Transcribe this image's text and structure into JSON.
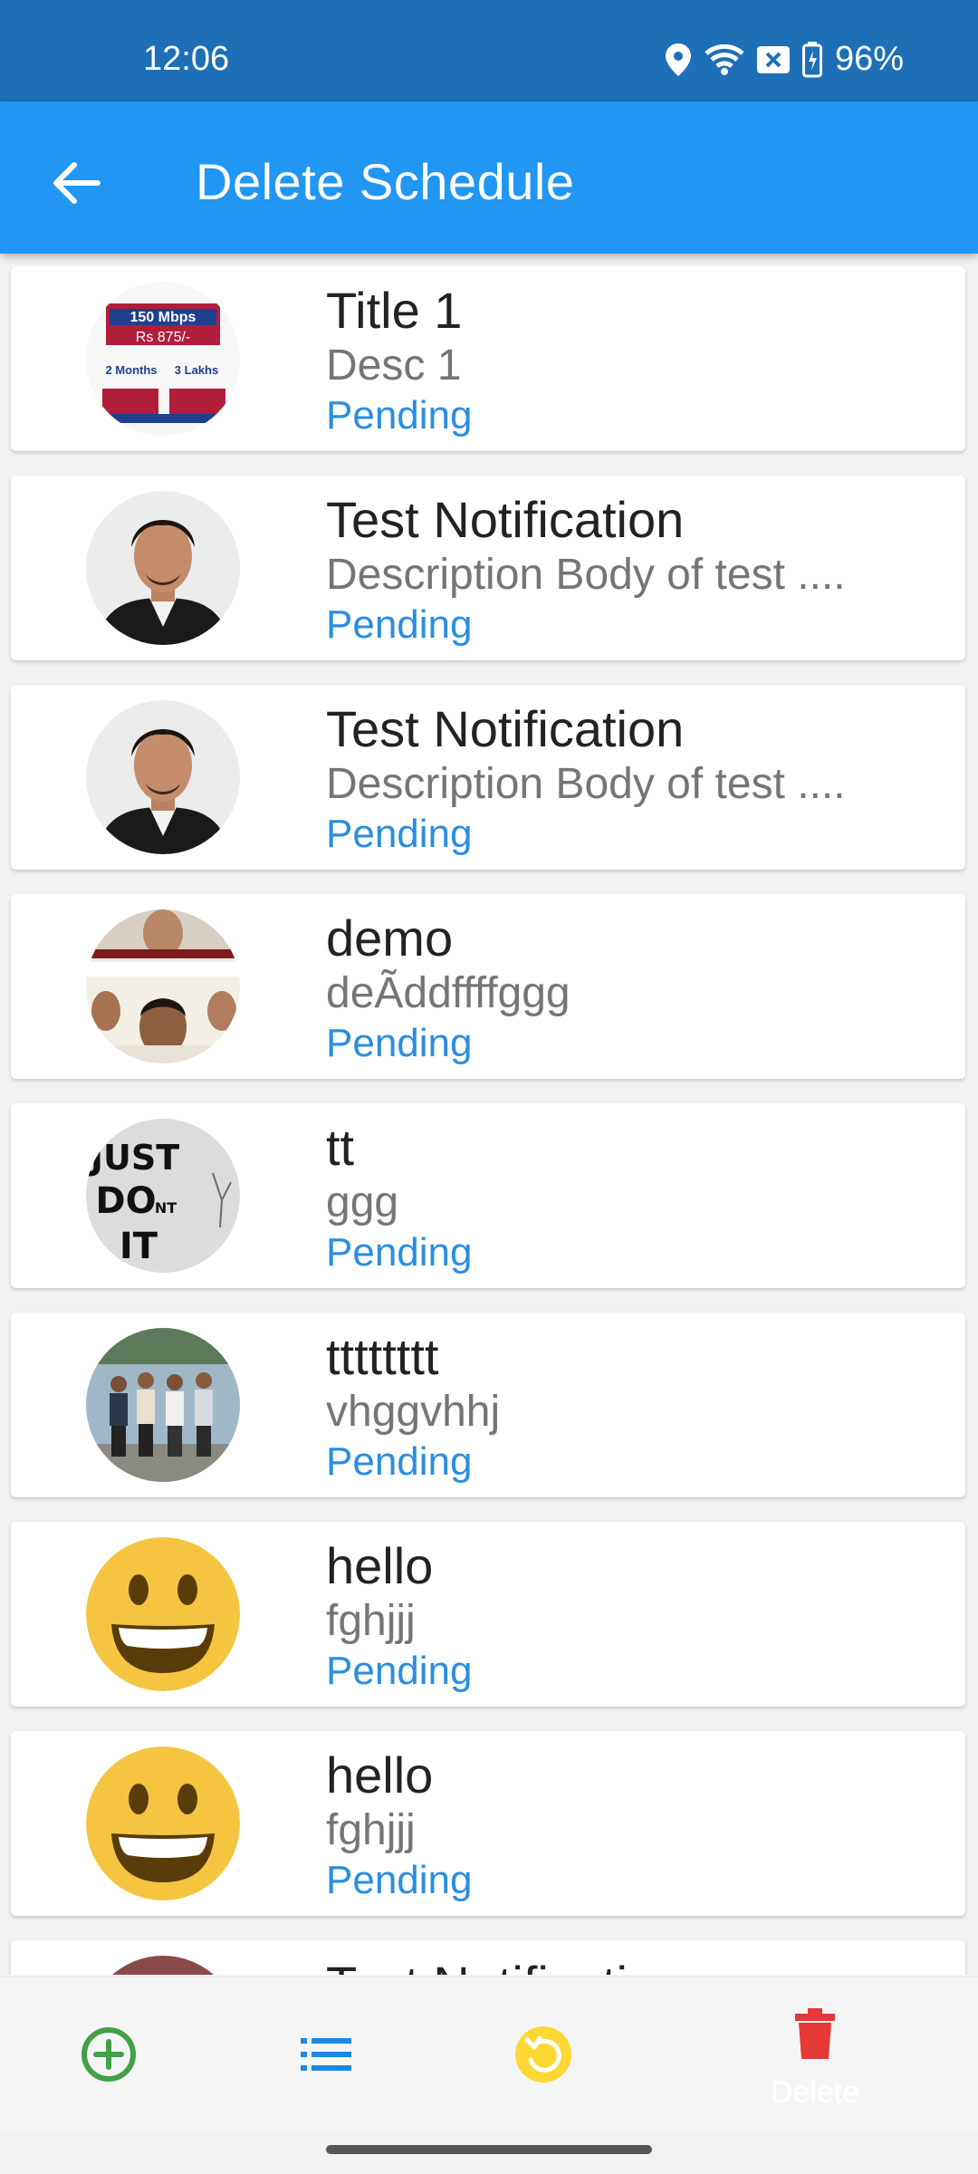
{
  "status_bar": {
    "time": "12:06",
    "battery": "96%"
  },
  "app_bar": {
    "title": "Delete Schedule"
  },
  "items": [
    {
      "title": "Title 1",
      "desc": "Desc 1",
      "status": "Pending",
      "avatar": "ad-banner-image"
    },
    {
      "title": "Test Notification",
      "desc": "Description Body of test ....",
      "status": "Pending",
      "avatar": "man-portrait-image"
    },
    {
      "title": "Test Notification",
      "desc": "Description Body of test ....",
      "status": "Pending",
      "avatar": "man-portrait-image"
    },
    {
      "title": "demo",
      "desc": "deÃddffffggg",
      "status": "Pending",
      "avatar": "actors-collage-image"
    },
    {
      "title": "tt",
      "desc": "ggg",
      "status": "Pending",
      "avatar": "just-do-it-image"
    },
    {
      "title": "tttttttt",
      "desc": "vhggvhhj",
      "status": "Pending",
      "avatar": "group-photo-image"
    },
    {
      "title": "hello",
      "desc": "fghjjj",
      "status": "Pending",
      "avatar": "smiley-emoji-image"
    },
    {
      "title": "hello",
      "desc": "fghjjj",
      "status": "Pending",
      "avatar": "smiley-emoji-image"
    },
    {
      "title": "Test Notification",
      "desc": "",
      "status": "",
      "avatar": "man-portrait-image"
    }
  ],
  "bottom_nav": {
    "add_icon": "add-circle-icon",
    "list_icon": "list-icon",
    "refresh_icon": "refresh-icon",
    "delete_icon": "trash-icon",
    "delete_label": "Delete"
  },
  "colors": {
    "status_bar": "#1e6fb6",
    "app_bar": "#2196f3",
    "pending": "#2a8ee0",
    "add": "#43a047",
    "list": "#1e88e5",
    "refresh": "#fdd835",
    "delete": "#e53935"
  }
}
